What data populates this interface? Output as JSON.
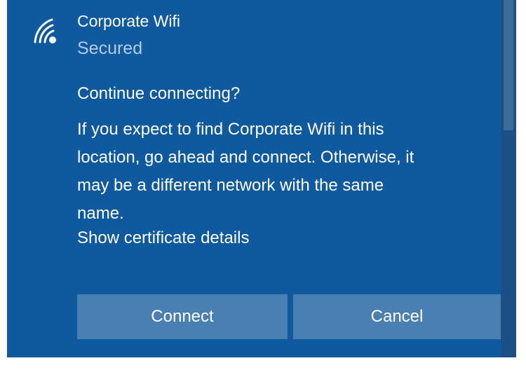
{
  "network": {
    "name": "Corporate Wifi",
    "status": "Secured",
    "icon": "wifi-signal-icon"
  },
  "dialog": {
    "prompt": "Continue connecting?",
    "message_lines": [
      "If you expect to find Corporate Wifi in this",
      "location, go ahead and connect. Otherwise, it",
      "may be a different network with the same",
      "name."
    ],
    "certificate_link": "Show certificate details"
  },
  "buttons": {
    "connect_label": "Connect",
    "cancel_label": "Cancel"
  },
  "colors": {
    "background": "#0f5a9e",
    "button": "#4a7fb2",
    "status_text": "#b4cce3"
  }
}
